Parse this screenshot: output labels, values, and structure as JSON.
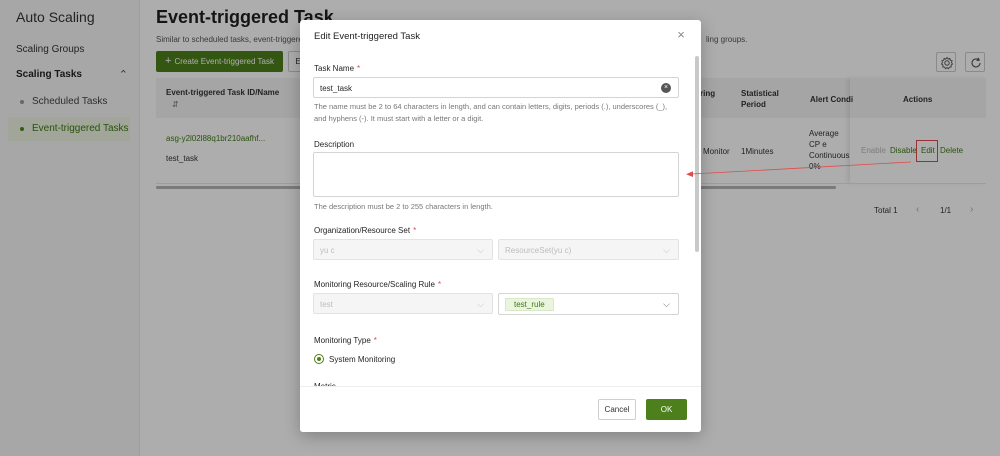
{
  "sidebar": {
    "title": "Auto Scaling",
    "items": {
      "scaling_groups": "Scaling Groups",
      "scaling_tasks": "Scaling Tasks",
      "scheduled_tasks": "Scheduled Tasks",
      "event_triggered_tasks": "Event-triggered Tasks"
    }
  },
  "page": {
    "title": "Event-triggered Task",
    "description_head": "Similar to scheduled tasks, event-triggere",
    "description_tail": "ling groups.",
    "create_button": "Create Event-triggered Task",
    "second_button": "E"
  },
  "table": {
    "headers": {
      "id_name": "Event-triggered Task ID/Name",
      "monitoring_fragment": "ring",
      "statistical_period": "Statistical Period",
      "alert_condition": "Alert Condi",
      "actions": "Actions"
    },
    "row": {
      "id": "asg-y2l02l88q1br210aafhf...",
      "name": "test_task",
      "monitoring": "Monitor",
      "period": "1Minutes",
      "alert_condition": "Average CP e Continuous 0%",
      "actions": {
        "enable": "Enable",
        "disable": "Disable",
        "edit": "Edit",
        "delete": "Delete"
      }
    },
    "pagination": {
      "total": "Total 1",
      "page": "1/1"
    }
  },
  "modal": {
    "title": "Edit Event-triggered Task",
    "task_name": {
      "label": "Task Name",
      "value": "test_task",
      "hint": "The name must be 2 to 64 characters in length, and can contain letters, digits, periods (.), underscores (_), and hyphens (-). It must start with a letter or a digit."
    },
    "description": {
      "label": "Description",
      "value": "",
      "hint": "The description must be 2 to 255 characters in length."
    },
    "org_resource_set": {
      "label": "Organization/Resource Set",
      "organization": "yu c",
      "resource_set": "ResourceSet(yu c)"
    },
    "monitoring_resource": {
      "label": "Monitoring Resource/Scaling Rule",
      "resource": "test",
      "scaling_rule": "test_rule"
    },
    "monitoring_type": {
      "label": "Monitoring Type",
      "option": "System Monitoring",
      "selected": true
    },
    "next_label": "Metric",
    "cancel": "Cancel",
    "ok": "OK"
  },
  "colors": {
    "brand_green": "#4d7f1c",
    "link_green": "#3d7a14",
    "required_red": "#e5484d",
    "annotation_red": "#e04a4a"
  }
}
